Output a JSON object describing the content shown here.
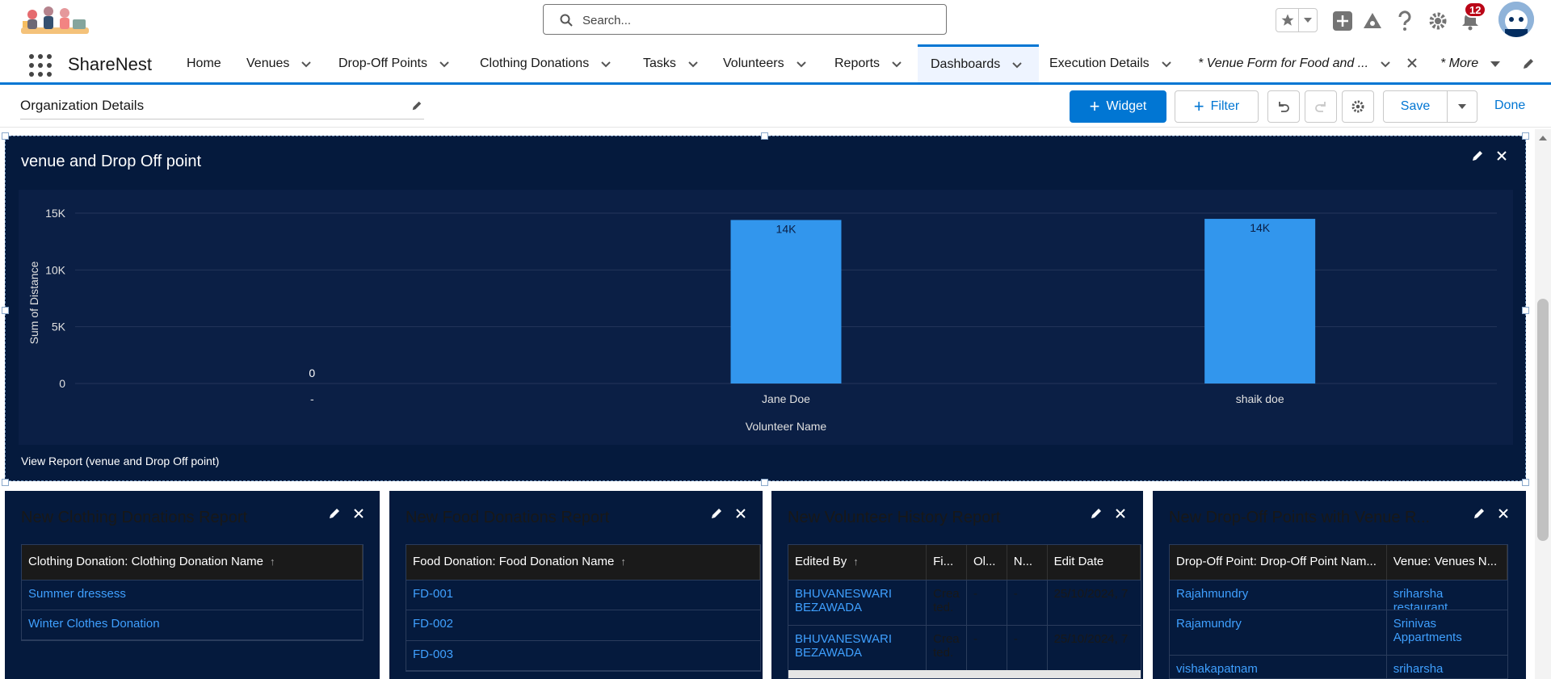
{
  "header": {
    "search_placeholder": "Search...",
    "notification_count": "12"
  },
  "nav": {
    "app_name": "ShareNest",
    "items": [
      {
        "label": "Home"
      },
      {
        "label": "Venues"
      },
      {
        "label": "Drop-Off Points"
      },
      {
        "label": "Clothing Donations"
      },
      {
        "label": "Tasks"
      },
      {
        "label": "Volunteers"
      },
      {
        "label": "Reports"
      },
      {
        "label": "Dashboards"
      },
      {
        "label": "Execution Details"
      },
      {
        "label": "* Venue Form for Food and ..."
      },
      {
        "label": "* More"
      }
    ]
  },
  "toolbar": {
    "dashboard_name": "Organization Details",
    "widget_label": "Widget",
    "filter_label": "Filter",
    "save_label": "Save",
    "done_label": "Done"
  },
  "main_widget": {
    "title": "venue and Drop Off point",
    "view_report": "View Report (venue and Drop Off point)"
  },
  "chart_data": {
    "type": "bar",
    "title": "venue and Drop Off point",
    "xlabel": "Volunteer Name",
    "ylabel": "Sum of Distance",
    "categories": [
      "-",
      "Jane Doe",
      "shaik doe"
    ],
    "values": [
      0,
      14400,
      14500
    ],
    "data_labels": [
      "0",
      "14K",
      "14K"
    ],
    "yticks": [
      "0",
      "5K",
      "10K",
      "15K"
    ],
    "ylim": [
      0,
      15500
    ],
    "bar_color": "#3296ed",
    "grid": true
  },
  "tables": [
    {
      "title": "New Clothing Donations Report",
      "columns": [
        "Clothing Donation: Clothing Donation Name"
      ],
      "rows": [
        [
          "Summer dressess"
        ],
        [
          "Winter Clothes Donation"
        ]
      ]
    },
    {
      "title": "New Food Donations Report",
      "columns": [
        "Food Donation: Food Donation Name"
      ],
      "rows": [
        [
          "FD-001"
        ],
        [
          "FD-002"
        ],
        [
          "FD-003"
        ]
      ]
    },
    {
      "title": "New Volunteer History Report",
      "columns": [
        "Edited By",
        "Fi...",
        "Ol...",
        "N...",
        "Edit Date"
      ],
      "rows": [
        [
          "BHUVANESWARI BEZAWADA",
          "Crea ted.",
          "-",
          "-",
          "25/10/2024, 7"
        ],
        [
          "BHUVANESWARI BEZAWADA",
          "Crea ted.",
          "-",
          "-",
          "25/10/2024, 7"
        ]
      ]
    },
    {
      "title": "New Drop-Off Points with Venue R...",
      "columns": [
        "Drop-Off Point: Drop-Off Point Nam...",
        "Venue: Venues N..."
      ],
      "rows": [
        [
          "Rajahmundry",
          "sriharsha restaurant"
        ],
        [
          "Rajamundry",
          "Srinivas Appartments"
        ],
        [
          "vishakapatnam",
          "sriharsha restaurant"
        ]
      ]
    }
  ]
}
